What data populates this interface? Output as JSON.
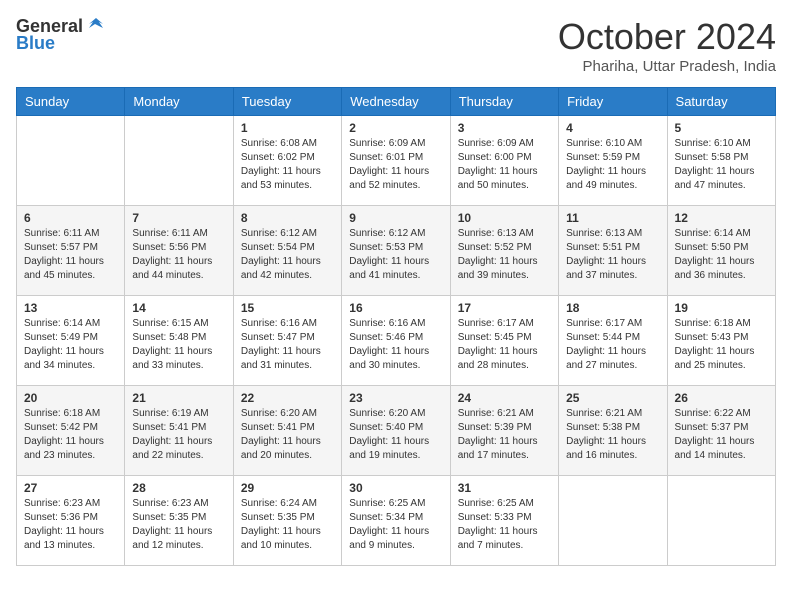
{
  "header": {
    "logo_general": "General",
    "logo_blue": "Blue",
    "month_title": "October 2024",
    "location": "Phariha, Uttar Pradesh, India"
  },
  "days_of_week": [
    "Sunday",
    "Monday",
    "Tuesday",
    "Wednesday",
    "Thursday",
    "Friday",
    "Saturday"
  ],
  "weeks": [
    [
      {
        "day": "",
        "sunrise": "",
        "sunset": "",
        "daylight": ""
      },
      {
        "day": "",
        "sunrise": "",
        "sunset": "",
        "daylight": ""
      },
      {
        "day": "1",
        "sunrise": "Sunrise: 6:08 AM",
        "sunset": "Sunset: 6:02 PM",
        "daylight": "Daylight: 11 hours and 53 minutes."
      },
      {
        "day": "2",
        "sunrise": "Sunrise: 6:09 AM",
        "sunset": "Sunset: 6:01 PM",
        "daylight": "Daylight: 11 hours and 52 minutes."
      },
      {
        "day": "3",
        "sunrise": "Sunrise: 6:09 AM",
        "sunset": "Sunset: 6:00 PM",
        "daylight": "Daylight: 11 hours and 50 minutes."
      },
      {
        "day": "4",
        "sunrise": "Sunrise: 6:10 AM",
        "sunset": "Sunset: 5:59 PM",
        "daylight": "Daylight: 11 hours and 49 minutes."
      },
      {
        "day": "5",
        "sunrise": "Sunrise: 6:10 AM",
        "sunset": "Sunset: 5:58 PM",
        "daylight": "Daylight: 11 hours and 47 minutes."
      }
    ],
    [
      {
        "day": "6",
        "sunrise": "Sunrise: 6:11 AM",
        "sunset": "Sunset: 5:57 PM",
        "daylight": "Daylight: 11 hours and 45 minutes."
      },
      {
        "day": "7",
        "sunrise": "Sunrise: 6:11 AM",
        "sunset": "Sunset: 5:56 PM",
        "daylight": "Daylight: 11 hours and 44 minutes."
      },
      {
        "day": "8",
        "sunrise": "Sunrise: 6:12 AM",
        "sunset": "Sunset: 5:54 PM",
        "daylight": "Daylight: 11 hours and 42 minutes."
      },
      {
        "day": "9",
        "sunrise": "Sunrise: 6:12 AM",
        "sunset": "Sunset: 5:53 PM",
        "daylight": "Daylight: 11 hours and 41 minutes."
      },
      {
        "day": "10",
        "sunrise": "Sunrise: 6:13 AM",
        "sunset": "Sunset: 5:52 PM",
        "daylight": "Daylight: 11 hours and 39 minutes."
      },
      {
        "day": "11",
        "sunrise": "Sunrise: 6:13 AM",
        "sunset": "Sunset: 5:51 PM",
        "daylight": "Daylight: 11 hours and 37 minutes."
      },
      {
        "day": "12",
        "sunrise": "Sunrise: 6:14 AM",
        "sunset": "Sunset: 5:50 PM",
        "daylight": "Daylight: 11 hours and 36 minutes."
      }
    ],
    [
      {
        "day": "13",
        "sunrise": "Sunrise: 6:14 AM",
        "sunset": "Sunset: 5:49 PM",
        "daylight": "Daylight: 11 hours and 34 minutes."
      },
      {
        "day": "14",
        "sunrise": "Sunrise: 6:15 AM",
        "sunset": "Sunset: 5:48 PM",
        "daylight": "Daylight: 11 hours and 33 minutes."
      },
      {
        "day": "15",
        "sunrise": "Sunrise: 6:16 AM",
        "sunset": "Sunset: 5:47 PM",
        "daylight": "Daylight: 11 hours and 31 minutes."
      },
      {
        "day": "16",
        "sunrise": "Sunrise: 6:16 AM",
        "sunset": "Sunset: 5:46 PM",
        "daylight": "Daylight: 11 hours and 30 minutes."
      },
      {
        "day": "17",
        "sunrise": "Sunrise: 6:17 AM",
        "sunset": "Sunset: 5:45 PM",
        "daylight": "Daylight: 11 hours and 28 minutes."
      },
      {
        "day": "18",
        "sunrise": "Sunrise: 6:17 AM",
        "sunset": "Sunset: 5:44 PM",
        "daylight": "Daylight: 11 hours and 27 minutes."
      },
      {
        "day": "19",
        "sunrise": "Sunrise: 6:18 AM",
        "sunset": "Sunset: 5:43 PM",
        "daylight": "Daylight: 11 hours and 25 minutes."
      }
    ],
    [
      {
        "day": "20",
        "sunrise": "Sunrise: 6:18 AM",
        "sunset": "Sunset: 5:42 PM",
        "daylight": "Daylight: 11 hours and 23 minutes."
      },
      {
        "day": "21",
        "sunrise": "Sunrise: 6:19 AM",
        "sunset": "Sunset: 5:41 PM",
        "daylight": "Daylight: 11 hours and 22 minutes."
      },
      {
        "day": "22",
        "sunrise": "Sunrise: 6:20 AM",
        "sunset": "Sunset: 5:41 PM",
        "daylight": "Daylight: 11 hours and 20 minutes."
      },
      {
        "day": "23",
        "sunrise": "Sunrise: 6:20 AM",
        "sunset": "Sunset: 5:40 PM",
        "daylight": "Daylight: 11 hours and 19 minutes."
      },
      {
        "day": "24",
        "sunrise": "Sunrise: 6:21 AM",
        "sunset": "Sunset: 5:39 PM",
        "daylight": "Daylight: 11 hours and 17 minutes."
      },
      {
        "day": "25",
        "sunrise": "Sunrise: 6:21 AM",
        "sunset": "Sunset: 5:38 PM",
        "daylight": "Daylight: 11 hours and 16 minutes."
      },
      {
        "day": "26",
        "sunrise": "Sunrise: 6:22 AM",
        "sunset": "Sunset: 5:37 PM",
        "daylight": "Daylight: 11 hours and 14 minutes."
      }
    ],
    [
      {
        "day": "27",
        "sunrise": "Sunrise: 6:23 AM",
        "sunset": "Sunset: 5:36 PM",
        "daylight": "Daylight: 11 hours and 13 minutes."
      },
      {
        "day": "28",
        "sunrise": "Sunrise: 6:23 AM",
        "sunset": "Sunset: 5:35 PM",
        "daylight": "Daylight: 11 hours and 12 minutes."
      },
      {
        "day": "29",
        "sunrise": "Sunrise: 6:24 AM",
        "sunset": "Sunset: 5:35 PM",
        "daylight": "Daylight: 11 hours and 10 minutes."
      },
      {
        "day": "30",
        "sunrise": "Sunrise: 6:25 AM",
        "sunset": "Sunset: 5:34 PM",
        "daylight": "Daylight: 11 hours and 9 minutes."
      },
      {
        "day": "31",
        "sunrise": "Sunrise: 6:25 AM",
        "sunset": "Sunset: 5:33 PM",
        "daylight": "Daylight: 11 hours and 7 minutes."
      },
      {
        "day": "",
        "sunrise": "",
        "sunset": "",
        "daylight": ""
      },
      {
        "day": "",
        "sunrise": "",
        "sunset": "",
        "daylight": ""
      }
    ]
  ]
}
